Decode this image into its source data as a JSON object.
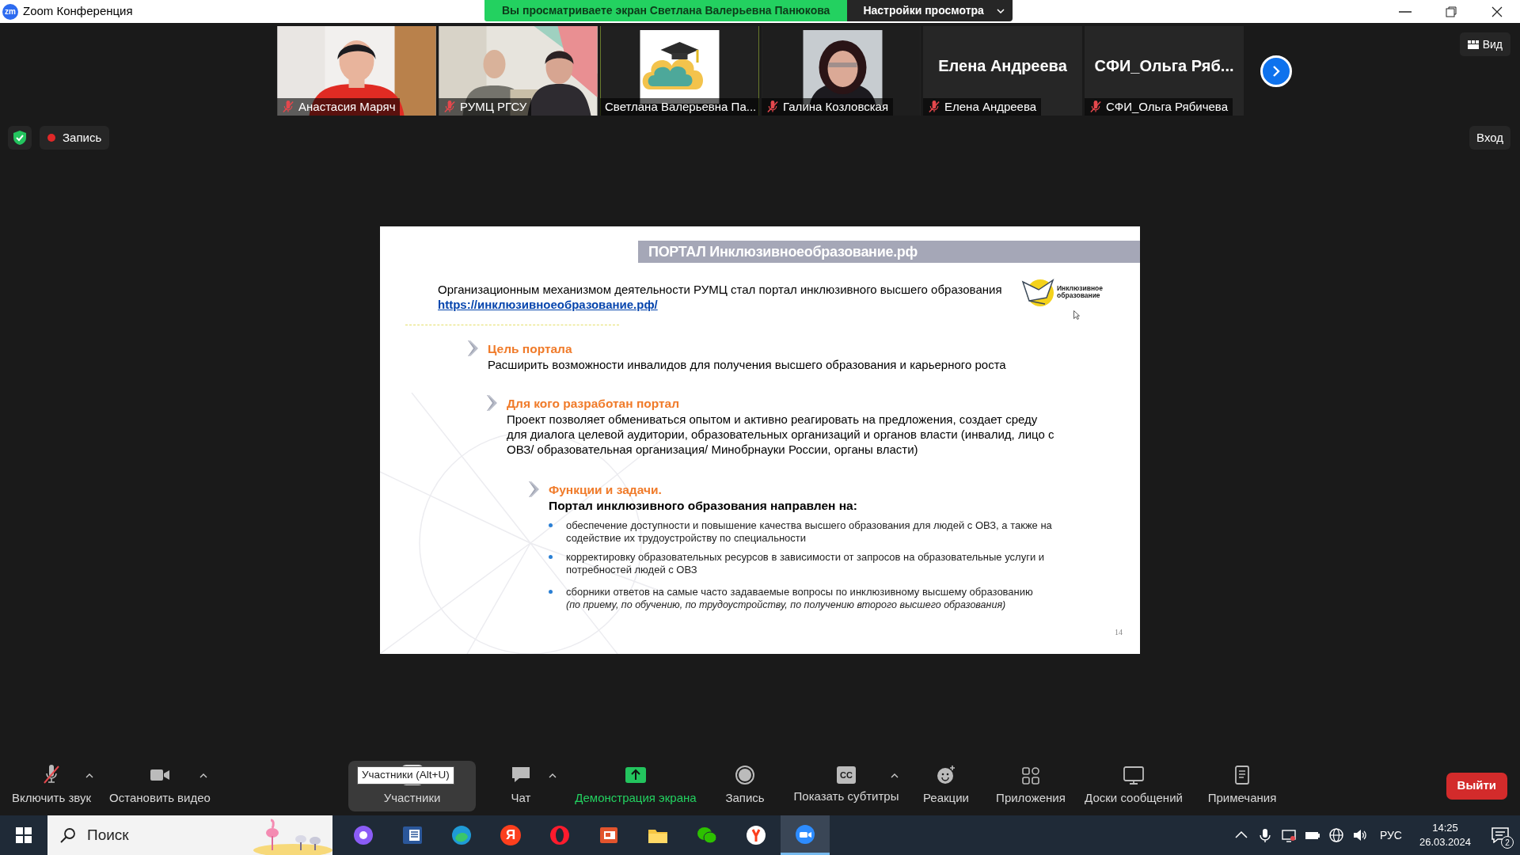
{
  "window": {
    "app_icon": "zm",
    "title": "Zoom Конференция"
  },
  "banner": {
    "text": "Вы просматриваете экран Светлана Валерьевна Панюкова",
    "view_settings": "Настройки просмотра"
  },
  "participants": [
    {
      "kind": "video",
      "label": "Анастасия Маряч",
      "muted": true,
      "selected": false
    },
    {
      "kind": "group_video",
      "label": "РУМЦ РГСУ",
      "muted": true,
      "selected": false
    },
    {
      "kind": "avatar",
      "label": "Светлана Валерьевна Па...",
      "muted": false,
      "selected": true
    },
    {
      "label": "Галина Козловская",
      "muted": true,
      "selected": false
    },
    {
      "kind": "name",
      "name": "Елена Андреева",
      "label": "Елена Андреева",
      "muted": true,
      "selected": false
    },
    {
      "kind": "name",
      "name": "СФИ_Ольга Ряб...",
      "label": "СФИ_Ольга Рябичева",
      "muted": true,
      "selected": false
    }
  ],
  "view_button": "Вид",
  "recording": {
    "label": "Запись"
  },
  "enter_button": "Вход",
  "slide": {
    "title": "ПОРТАЛ Инклюзивноеобразование.рф",
    "intro": "Организационным механизмом деятельности РУМЦ стал портал инклюзивного высшего образования",
    "link": "https://инклюзивноеобразование.рф/",
    "logo_text": [
      "Инклюзивное",
      "образование"
    ],
    "sections": [
      {
        "heading": "Цель портала",
        "text": "Расширить возможности инвалидов для получения высшего образования и карьерного роста"
      },
      {
        "heading": "Для кого разработан портал",
        "text": "Проект позволяет обмениваться опытом и активно реагировать на предложения, создает среду для диалога целевой аудитории, образовательных организаций и органов власти (инвалид, лицо с ОВЗ/ образовательная организация/ Минобрнауки России, органы власти)"
      },
      {
        "heading": "Функции и задачи.",
        "subheading": "Портал инклюзивного образования направлен на:",
        "bullets": [
          {
            "text": "обеспечение доступности и повышение качества высшего образования для людей с ОВЗ, а также на содействие их трудоустройству по специальности"
          },
          {
            "text": "корректировку образовательных ресурсов в зависимости от запросов на образовательные услуги и потребностей людей с ОВЗ"
          },
          {
            "text": "сборники ответов на самые часто задаваемые вопросы по инклюзивному высшему образованию",
            "note": "(по приему, по обучению, по трудоустройству, по получению второго высшего образования)"
          }
        ]
      }
    ],
    "page_number": "14"
  },
  "toolbar": {
    "items": [
      {
        "kind": "mic",
        "label": "Включить звук",
        "caret": true,
        "muted": true,
        "active": false
      },
      {
        "kind": "video",
        "label": "Остановить видео",
        "caret": true,
        "active": false
      },
      {
        "kind": "participants",
        "label": "Участники",
        "caret": false,
        "active": true
      },
      {
        "kind": "chat",
        "label": "Чат",
        "caret": true,
        "active": false
      },
      {
        "kind": "share",
        "label": "Демонстрация экрана",
        "caret": false,
        "active": false
      },
      {
        "kind": "record",
        "label": "Запись",
        "caret": false,
        "active": false
      },
      {
        "kind": "captions",
        "label": "Показать субтитры",
        "caret": true,
        "badge": "CC",
        "active": false
      },
      {
        "kind": "reactions",
        "label": "Реакции",
        "caret": false,
        "active": false
      },
      {
        "kind": "apps",
        "label": "Приложения",
        "caret": false,
        "active": false
      },
      {
        "kind": "whiteboard",
        "label": "Доски сообщений",
        "caret": false,
        "active": false
      },
      {
        "kind": "notes",
        "label": "Примечания",
        "caret": false,
        "active": false
      }
    ],
    "tooltip": "Участники (Alt+U)",
    "leave": "Выйти"
  },
  "taskbar": {
    "search_placeholder": "Поиск",
    "apps": [
      {
        "kind": "alice",
        "active": false
      },
      {
        "kind": "word",
        "active": false
      },
      {
        "kind": "edge",
        "active": false
      },
      {
        "kind": "yandex",
        "label": "Я",
        "active": false
      },
      {
        "kind": "opera",
        "active": false
      },
      {
        "kind": "slides",
        "active": false
      },
      {
        "kind": "folder",
        "active": false
      },
      {
        "kind": "wechat",
        "active": false
      },
      {
        "kind": "ybrowser",
        "active": false
      },
      {
        "kind": "zoom",
        "active": true
      }
    ],
    "language": "РУС",
    "time": "14:25",
    "date": "26.03.2024",
    "notifications": "2"
  }
}
